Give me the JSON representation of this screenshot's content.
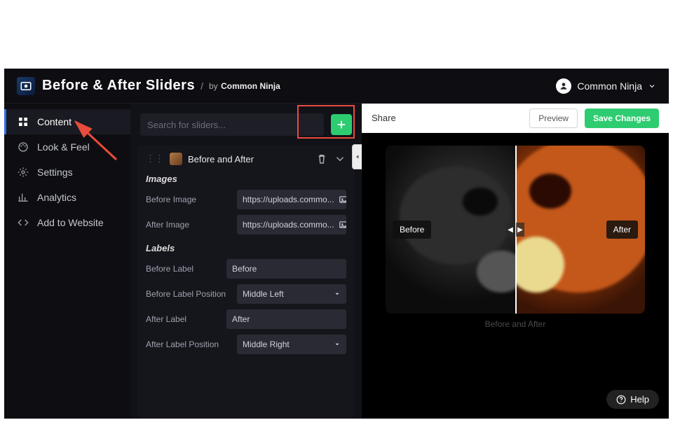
{
  "header": {
    "title": "Before & After Sliders",
    "by_prefix": "by",
    "owner": "Common Ninja",
    "user_name": "Common Ninja"
  },
  "sidebar": {
    "items": [
      {
        "label": "Content"
      },
      {
        "label": "Look & Feel"
      },
      {
        "label": "Settings"
      },
      {
        "label": "Analytics"
      },
      {
        "label": "Add to Website"
      }
    ]
  },
  "mid": {
    "search_placeholder": "Search for sliders...",
    "card_title": "Before and After",
    "sections": {
      "images": {
        "heading": "Images",
        "before_label": "Before Image",
        "after_label": "After Image",
        "before_value": "https://uploads.commo...",
        "after_value": "https://uploads.commo..."
      },
      "labels": {
        "heading": "Labels",
        "before_label_field": "Before Label",
        "before_label_value": "Before",
        "before_pos_field": "Before Label Position",
        "before_pos_value": "Middle Left",
        "after_label_field": "After Label",
        "after_label_value": "After",
        "after_pos_field": "After Label Position",
        "after_pos_value": "Middle Right"
      }
    }
  },
  "preview": {
    "share": "Share",
    "preview_btn": "Preview",
    "save_btn": "Save Changes",
    "before_tag": "Before",
    "after_tag": "After",
    "caption": "Before and After",
    "help": "Help"
  }
}
